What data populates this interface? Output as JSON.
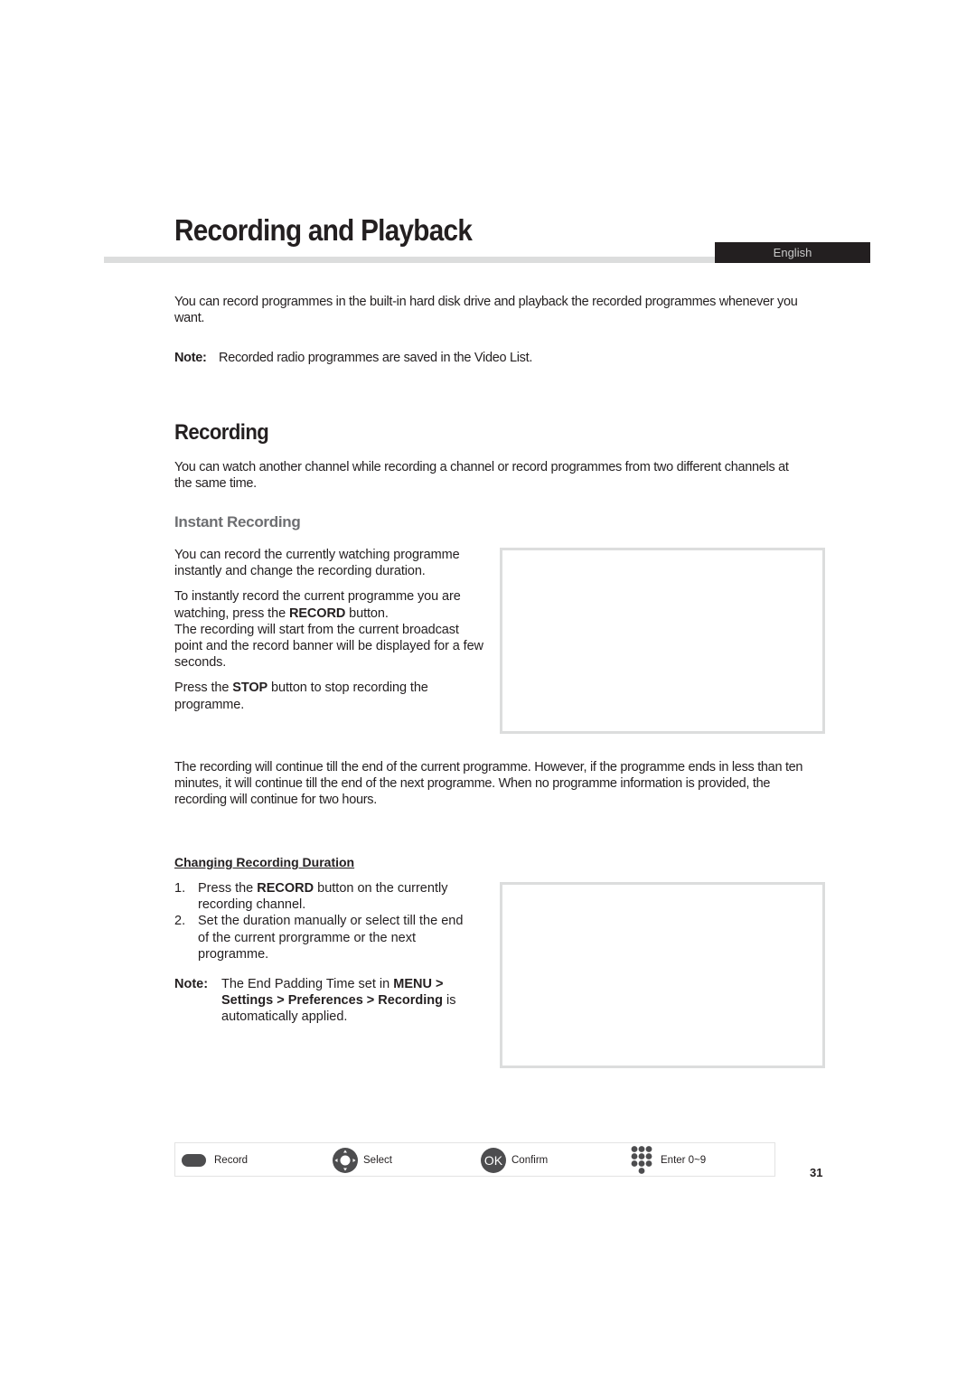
{
  "header": {
    "title": "Recording and Playback",
    "language_tab": "English"
  },
  "intro": {
    "paragraph": "You can record programmes in the built-in hard disk drive and playback the recorded programmes whenever you want.",
    "note_label": "Note:",
    "note_text": "Recorded radio programmes are saved in the Video List."
  },
  "recording": {
    "heading": "Recording",
    "paragraph": "You can watch another channel while recording a channel or record programmes from two different channels at the same time."
  },
  "instant_recording": {
    "heading": "Instant Recording",
    "p1": "You can record the currently watching programme instantly and change the recording duration.",
    "p2_before": "To instantly record the current programme you are watching, press the ",
    "p2_bold": "RECORD",
    "p2_after": " button.",
    "p3": "The recording will start from the current broadcast point and the record banner will be displayed for a few seconds.",
    "p4_before": "Press the ",
    "p4_bold": "STOP",
    "p4_after": " button to stop recording the programme.",
    "continue_paragraph": "The recording will continue till the end of the current programme. However, if the programme ends in less than ten minutes, it will continue till the end of the next programme. When no programme information is provided, the recording will continue for two hours."
  },
  "changing_duration": {
    "heading": "Changing Recording Duration",
    "steps": [
      {
        "num": "1.",
        "before": "Press the ",
        "bold": "RECORD",
        "after": " button on the currently recording channel."
      },
      {
        "num": "2.",
        "before": "Set the duration manually or select till the end of the current prorgramme or the next programme.",
        "bold": "",
        "after": ""
      }
    ],
    "note_label": "Note:",
    "note_before": "The End Padding Time set in ",
    "note_bold": "MENU > Settings > Preferences > Recording",
    "note_after": " is automatically applied."
  },
  "legend": {
    "items": [
      {
        "icon": "record-button-icon",
        "label": "Record"
      },
      {
        "icon": "dpad-icon",
        "label": "Select"
      },
      {
        "icon": "ok-button-icon",
        "label": "Confirm",
        "icon_text": "OK"
      },
      {
        "icon": "numeric-keypad-icon",
        "label": "Enter 0~9"
      }
    ]
  },
  "footer": {
    "page_number": "31"
  },
  "colors": {
    "text": "#231f20",
    "subheading_gray": "#6d6e71",
    "rule_gray": "#dcdddd",
    "tab_dark": "#231f20",
    "icon_dark": "#4d4d4f"
  }
}
